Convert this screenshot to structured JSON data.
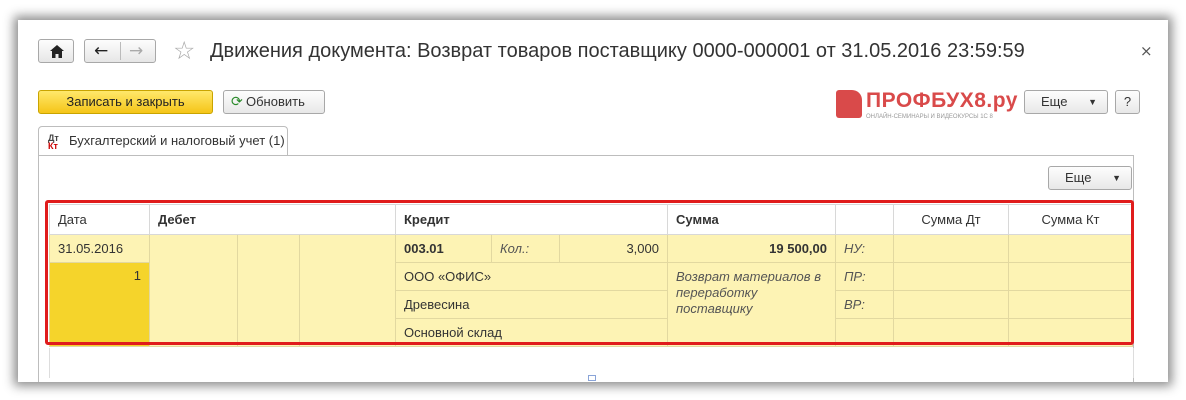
{
  "window": {
    "title": "Движения документа: Возврат товаров поставщику 0000-000001 от 31.05.2016 23:59:59",
    "close_glyph": "×"
  },
  "toolbar": {
    "save_close_label": "Записать и закрыть",
    "refresh_label": "Обновить",
    "more_label": "Еще",
    "help_label": "?"
  },
  "logo": {
    "text": "ПРОФБУХ8.ру",
    "subtitle": "ОНЛАЙН-СЕМИНАРЫ И ВИДЕОКУРСЫ 1С 8"
  },
  "tab": {
    "label": "Бухгалтерский и налоговый учет (1)",
    "icon_top": "Дт",
    "icon_bottom": "Кт"
  },
  "grid": {
    "more_label": "Еще",
    "headers": {
      "date": "Дата",
      "debit": "Дебет",
      "credit": "Кредит",
      "sum": "Сумма",
      "sum_dt": "Сумма Дт",
      "sum_kt": "Сумма Кт"
    },
    "row": {
      "date": "31.05.2016",
      "line_no": "1",
      "credit_account": "003.01",
      "qty_label": "Кол.:",
      "qty_value": "3,000",
      "sum": "19 500,00",
      "nu_label": "НУ:",
      "pr_label": "ПР:",
      "vr_label": "ВР:",
      "credit_sub1": "ООО «ОФИС»",
      "credit_sub2": "Древесина",
      "credit_sub3": "Основной склад",
      "content": "Возврат материалов в переработку поставщику"
    }
  },
  "colors": {
    "accent_yellow": "#f5c518",
    "row_yellow": "#fdf3b4",
    "highlight_red": "#e01c1c",
    "logo_red": "#d94a4a"
  }
}
